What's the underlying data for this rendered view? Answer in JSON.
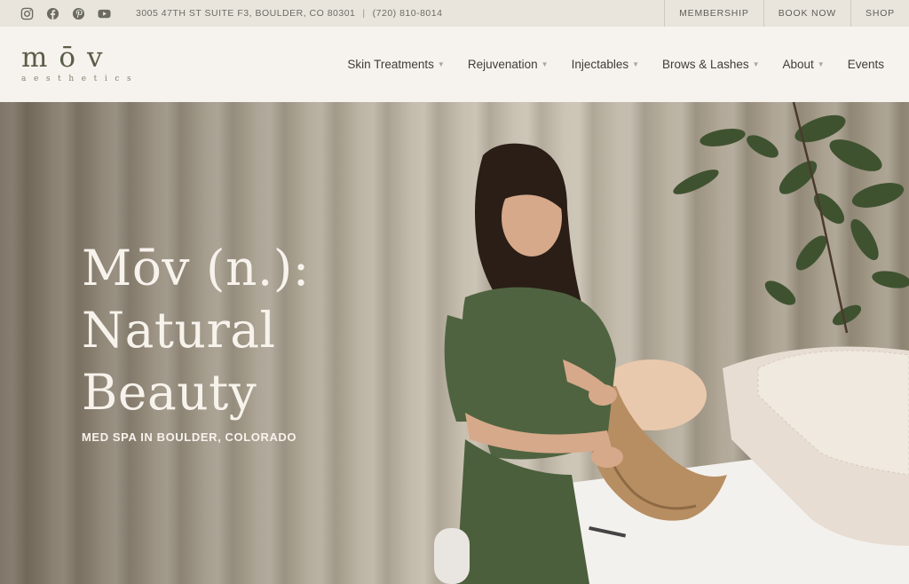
{
  "topbar": {
    "social": [
      {
        "icon": "instagram-icon"
      },
      {
        "icon": "facebook-icon"
      },
      {
        "icon": "pinterest-icon"
      },
      {
        "icon": "youtube-icon"
      }
    ],
    "address": "3005 47TH ST SUITE F3, BOULDER, CO 80301",
    "separator": "|",
    "phone": "(720) 810-8014",
    "links": [
      "MEMBERSHIP",
      "BOOK NOW",
      "SHOP"
    ]
  },
  "brand": {
    "logo_word": "mōv",
    "logo_sub": "aesthetics"
  },
  "nav": {
    "items": [
      {
        "label": "Skin Treatments",
        "has_dropdown": true
      },
      {
        "label": "Rejuvenation",
        "has_dropdown": true
      },
      {
        "label": "Injectables",
        "has_dropdown": true
      },
      {
        "label": "Brows & Lashes",
        "has_dropdown": true
      },
      {
        "label": "About",
        "has_dropdown": true
      },
      {
        "label": "Events",
        "has_dropdown": false
      }
    ]
  },
  "hero": {
    "title_lines": [
      "Mōv (n.):",
      "Natural",
      "Beauty"
    ],
    "subtitle": "MED SPA IN BOULDER, COLORADO"
  },
  "colors": {
    "topbar_bg": "#e9e5dd",
    "header_bg": "#f6f3ee",
    "brand_olive": "#5a5d47",
    "scrubs_green": "#4f6340",
    "hero_text": "#f7f3ec"
  }
}
